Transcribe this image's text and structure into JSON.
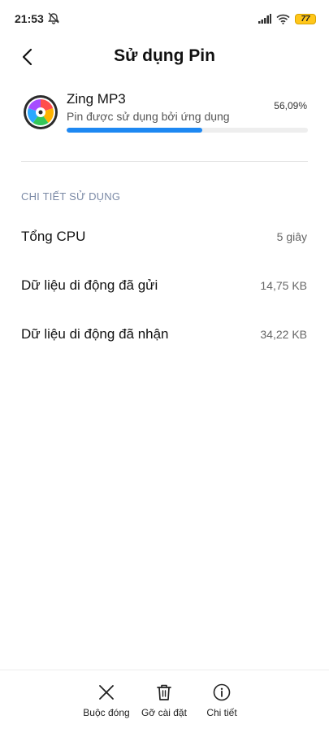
{
  "status_bar": {
    "time": "21:53",
    "battery_level": "77",
    "icons": [
      "alarm-off-icon",
      "signal-icon",
      "wifi-icon",
      "battery-icon"
    ]
  },
  "header": {
    "title": "Sử dụng Pin",
    "back_icon": "back-arrow-icon"
  },
  "app": {
    "name": "Zing MP3",
    "subtitle": "Pin được sử dụng bởi ứng dụng",
    "percent": "56,09%",
    "usage_fraction": 0.5609,
    "accent_color": "#1e88f2"
  },
  "details": {
    "section_title": "CHI TIẾT SỬ DỤNG",
    "rows": [
      {
        "label": "Tổng CPU",
        "value": "5 giây"
      },
      {
        "label": "Dữ liệu di động đã gửi",
        "value": "14,75 KB"
      },
      {
        "label": "Dữ liệu di động đã nhận",
        "value": "34,22 KB"
      }
    ]
  },
  "actions": [
    {
      "label": "Buộc đóng",
      "icon": "close-icon"
    },
    {
      "label": "Gỡ cài đặt",
      "icon": "trash-icon"
    },
    {
      "label": "Chi tiết",
      "icon": "info-icon"
    }
  ]
}
